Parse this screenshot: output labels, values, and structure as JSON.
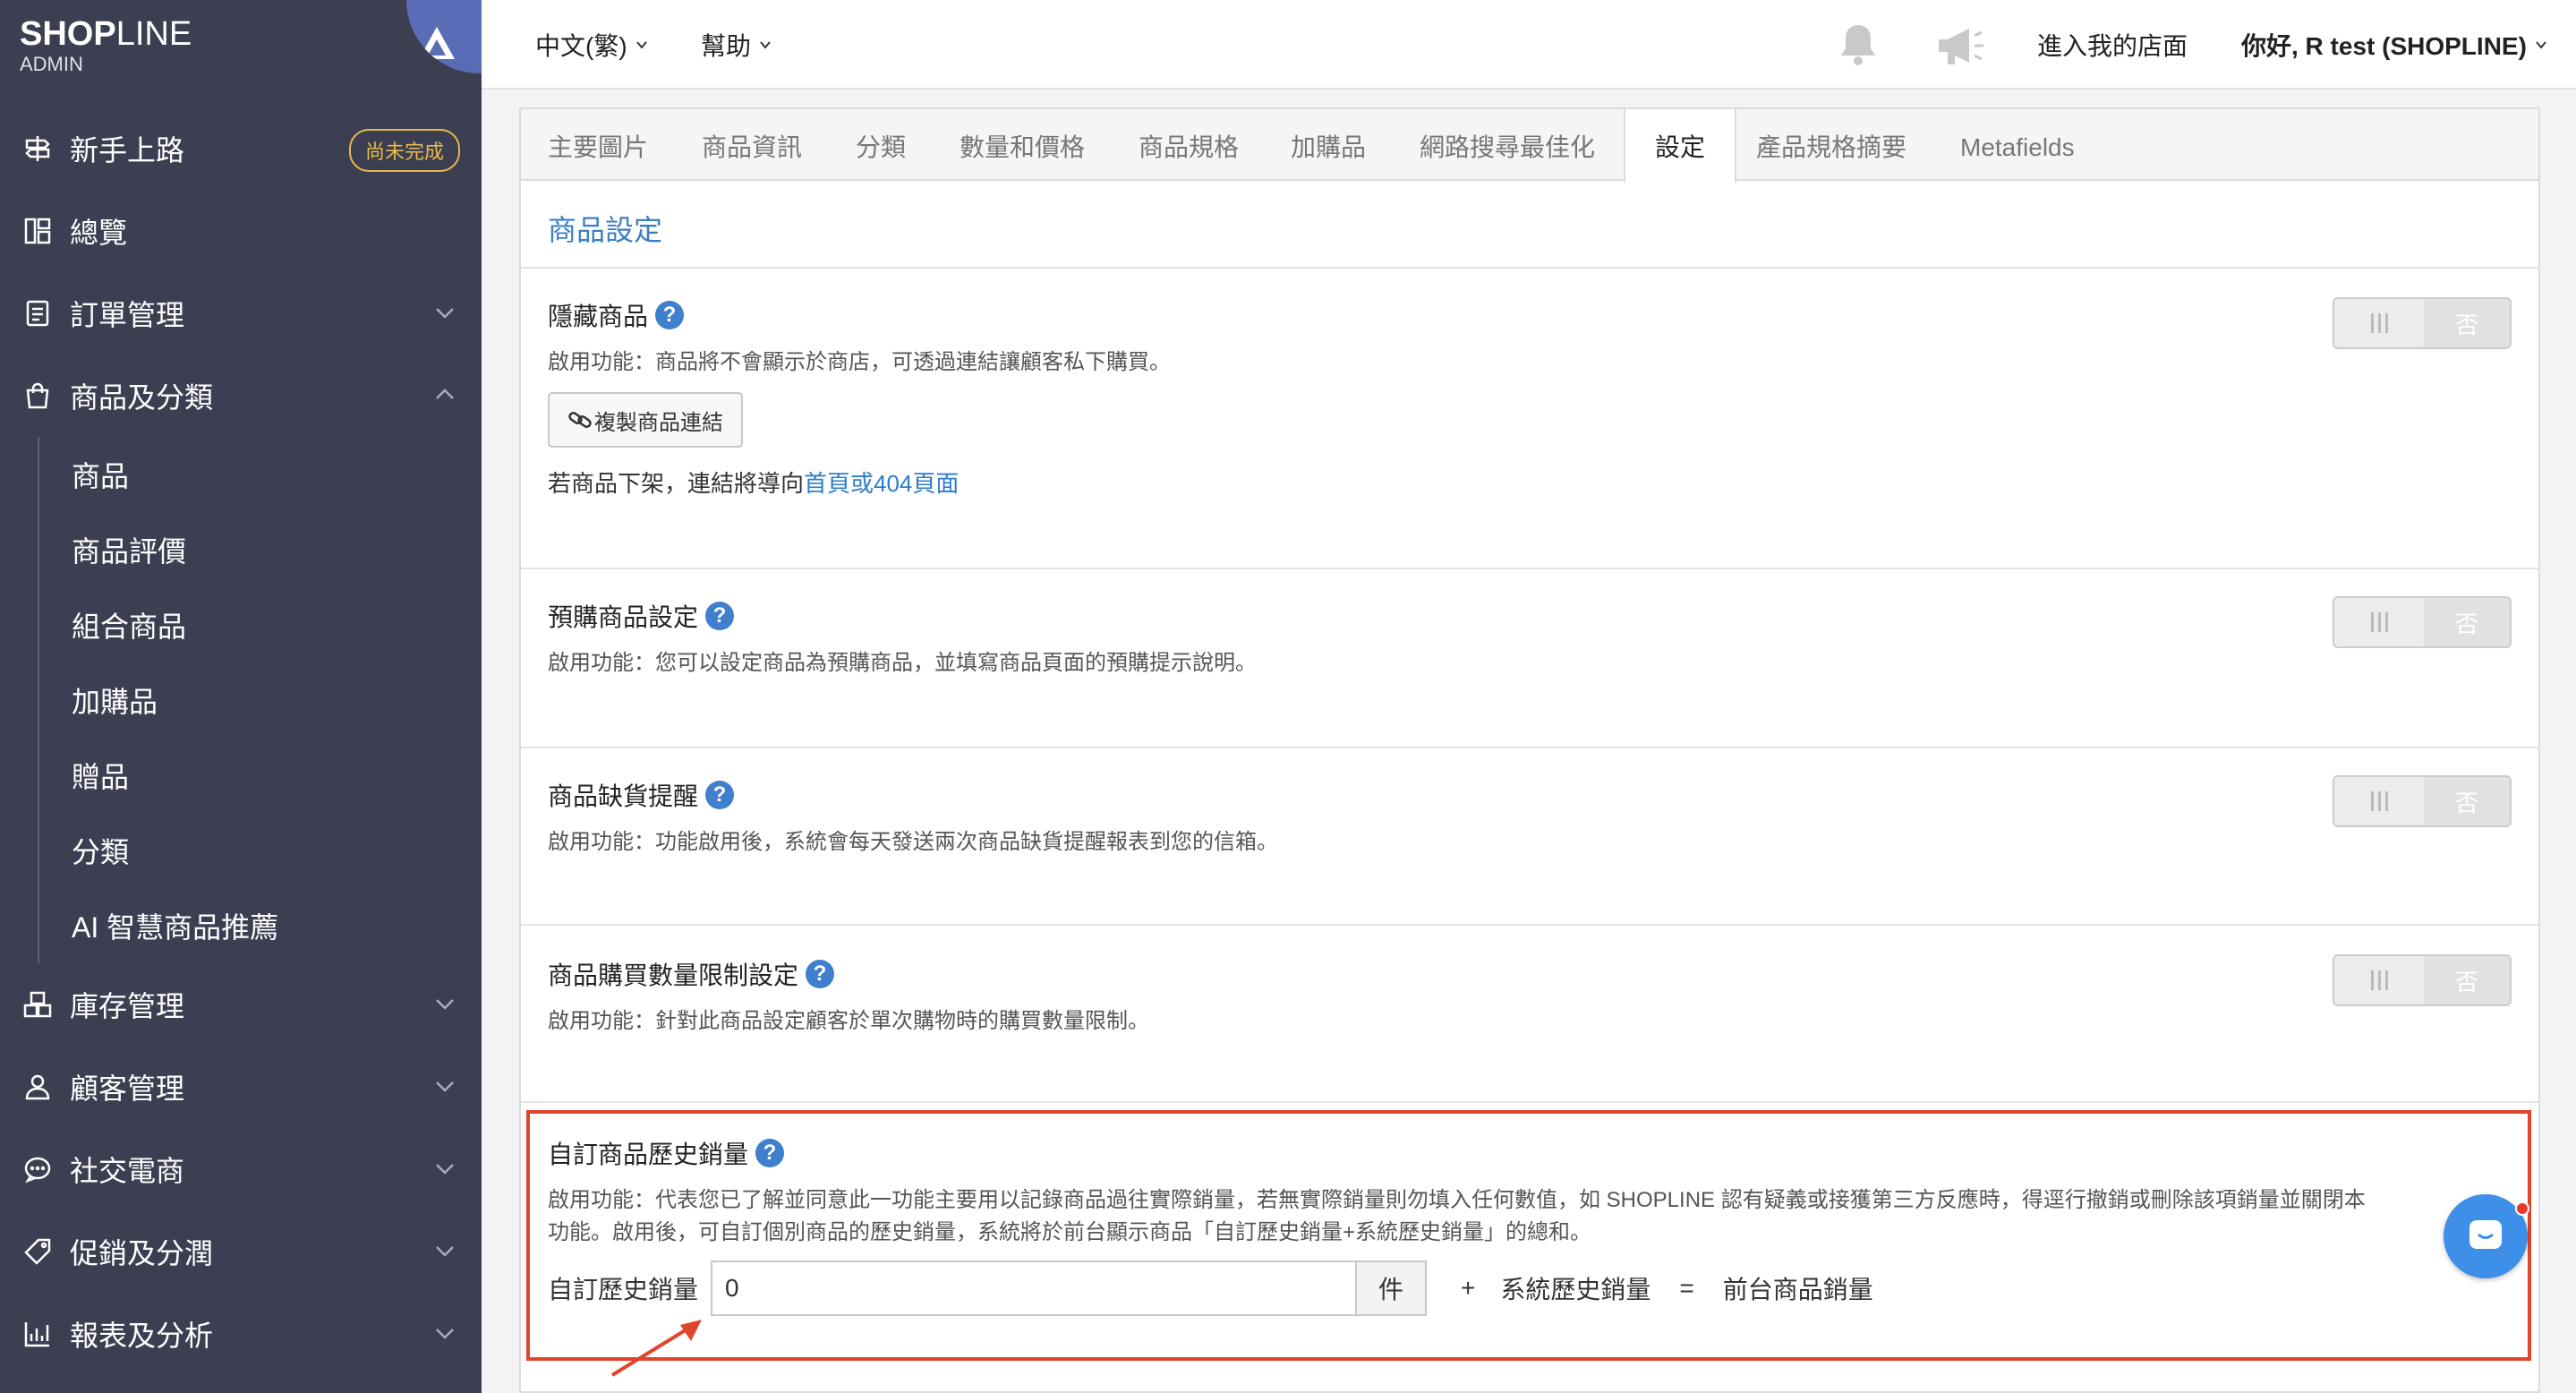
{
  "brand": {
    "name_bold": "SHOP",
    "name_rest": "LINE",
    "sub": "ADMIN"
  },
  "sidebar": {
    "items": [
      {
        "label": "新手上路",
        "icon": "signpost-icon",
        "badge": "尚未完成"
      },
      {
        "label": "總覽",
        "icon": "dashboard-icon"
      },
      {
        "label": "訂單管理",
        "icon": "order-list-icon"
      },
      {
        "label": "商品及分類",
        "icon": "shopping-bag-icon"
      },
      {
        "label": "庫存管理",
        "icon": "inventory-icon"
      },
      {
        "label": "顧客管理",
        "icon": "user-icon"
      },
      {
        "label": "社交電商",
        "icon": "chat-bubble-icon"
      },
      {
        "label": "促銷及分潤",
        "icon": "tag-icon"
      },
      {
        "label": "報表及分析",
        "icon": "report-chart-icon"
      }
    ],
    "subitems": [
      "商品",
      "商品評價",
      "組合商品",
      "加購品",
      "贈品",
      "分類",
      "AI 智慧商品推薦"
    ]
  },
  "header": {
    "language": "中文(繁)",
    "help": "幫助",
    "store_link": "進入我的店面",
    "greeting": "你好, R test (SHOPLINE)"
  },
  "tabs": [
    "主要圖片",
    "商品資訊",
    "分類",
    "數量和價格",
    "商品規格",
    "加購品",
    "網路搜尋最佳化",
    "設定",
    "產品規格摘要",
    "Metafields"
  ],
  "active_tab": "設定",
  "settings": {
    "title": "商品設定",
    "hidden": {
      "title": "隱藏商品",
      "desc": "啟用功能：商品將不會顯示於商店，可透過連結讓顧客私下購買。",
      "copy_button": "複製商品連結",
      "note_prefix": "若商品下架，連結將導向",
      "note_link": "首頁或404頁面"
    },
    "preorder": {
      "title": "預購商品設定",
      "desc": "啟用功能：您可以設定商品為預購商品，並填寫商品頁面的預購提示說明。"
    },
    "stock_alert": {
      "title": "商品缺貨提醒",
      "desc": "啟用功能：功能啟用後，系統會每天發送兩次商品缺貨提醒報表到您的信箱。"
    },
    "purchase_limit": {
      "title": "商品購買數量限制設定",
      "desc": "啟用功能：針對此商品設定顧客於單次購物時的購買數量限制。"
    },
    "history_sales": {
      "title": "自訂商品歷史銷量",
      "desc_line1": "啟用功能：代表您已了解並同意此一功能主要用以記錄商品過往實際銷量，若無實際銷量則勿填入任何數值，如 SHOPLINE 認有疑義或接獲第三方反應時，得逕行撤銷或刪除該項銷量並關閉本",
      "desc_line2": "功能。啟用後，可自訂個別商品的歷史銷量，系統將於前台顯示商品「自訂歷史銷量+系統歷史銷量」的總和。",
      "input_label": "自訂歷史銷量",
      "input_value": "0",
      "unit": "件",
      "plus": "+",
      "system_label": "系統歷史銷量",
      "equals": "=",
      "result_label": "前台商品銷量"
    },
    "toggle_off_label": "否"
  },
  "colors": {
    "sidebar_bg": "#3b3f51",
    "accent_blue": "#3b7fc4",
    "highlight_red": "#e2432b",
    "badge_gold": "#e9b94a"
  }
}
